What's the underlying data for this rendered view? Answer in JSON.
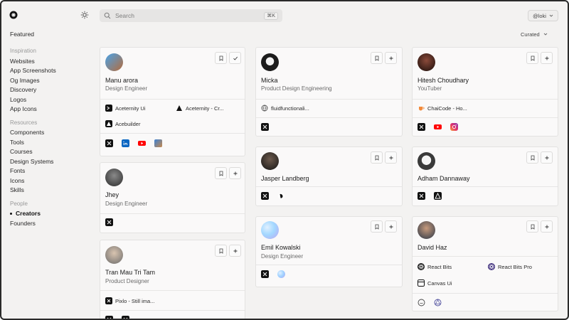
{
  "topbar": {
    "search_placeholder": "Search",
    "search_shortcut": "⌘K",
    "user_label": "@loki",
    "sort_label": "Curated"
  },
  "sidebar": {
    "featured": "Featured",
    "inspiration_heading": "Inspiration",
    "inspiration": [
      "Websites",
      "App Screenshots",
      "Og Images",
      "Discovery",
      "Logos",
      "App Icons"
    ],
    "resources_heading": "Resources",
    "resources": [
      "Components",
      "Tools",
      "Courses",
      "Design Systems",
      "Fonts",
      "Icons",
      "Skills"
    ],
    "people_heading": "People",
    "people": [
      "Creators",
      "Founders"
    ],
    "active_item": "Creators"
  },
  "creators": [
    {
      "name": "Manu arora",
      "role": "Design Engineer",
      "saved": true,
      "projects": [
        "Aceternity Ui",
        "Aceternity - Cr...",
        "Acebuilder"
      ],
      "socials": [
        "x-icon",
        "linkedin-icon",
        "youtube-icon",
        "website-icon"
      ]
    },
    {
      "name": "Jhey",
      "role": "Design Engineer",
      "projects": [],
      "socials": [
        "x-icon"
      ]
    },
    {
      "name": "Tran Mau Tri Tam",
      "role": "Product Designer",
      "projects": [
        "Pixlo - Still ima..."
      ],
      "socials": [
        "x-icon",
        "x-icon"
      ]
    },
    {
      "name": "Micka",
      "role": "Product Design Engineering",
      "projects": [
        "fluidfunctionali..."
      ],
      "socials": [
        "x-icon"
      ]
    },
    {
      "name": "Jasper Landberg",
      "role": "",
      "projects": [],
      "socials": [
        "x-icon",
        "website-icon"
      ]
    },
    {
      "name": "Emil Kowalski",
      "role": "Design Engineer",
      "projects": [],
      "socials": [
        "x-icon",
        "website-icon"
      ]
    },
    {
      "name": "Hitesh Choudhary",
      "role": "YouTuber",
      "projects": [
        "ChaiCode - Ho..."
      ],
      "socials": [
        "x-icon",
        "youtube-icon",
        "instagram-icon"
      ]
    },
    {
      "name": "Adham Dannaway",
      "role": "",
      "projects": [],
      "socials": [
        "x-icon",
        "website-icon"
      ]
    },
    {
      "name": "David Haz",
      "role": "",
      "projects": [
        "React Bits",
        "React Bits Pro",
        "Canvas Ui"
      ],
      "socials": [
        "github-icon",
        "website-icon"
      ]
    }
  ],
  "colors": {
    "background": "#f3f2f1",
    "card": "#faf9f9",
    "text": "#1a1a1a",
    "muted": "#6a6a6a"
  }
}
